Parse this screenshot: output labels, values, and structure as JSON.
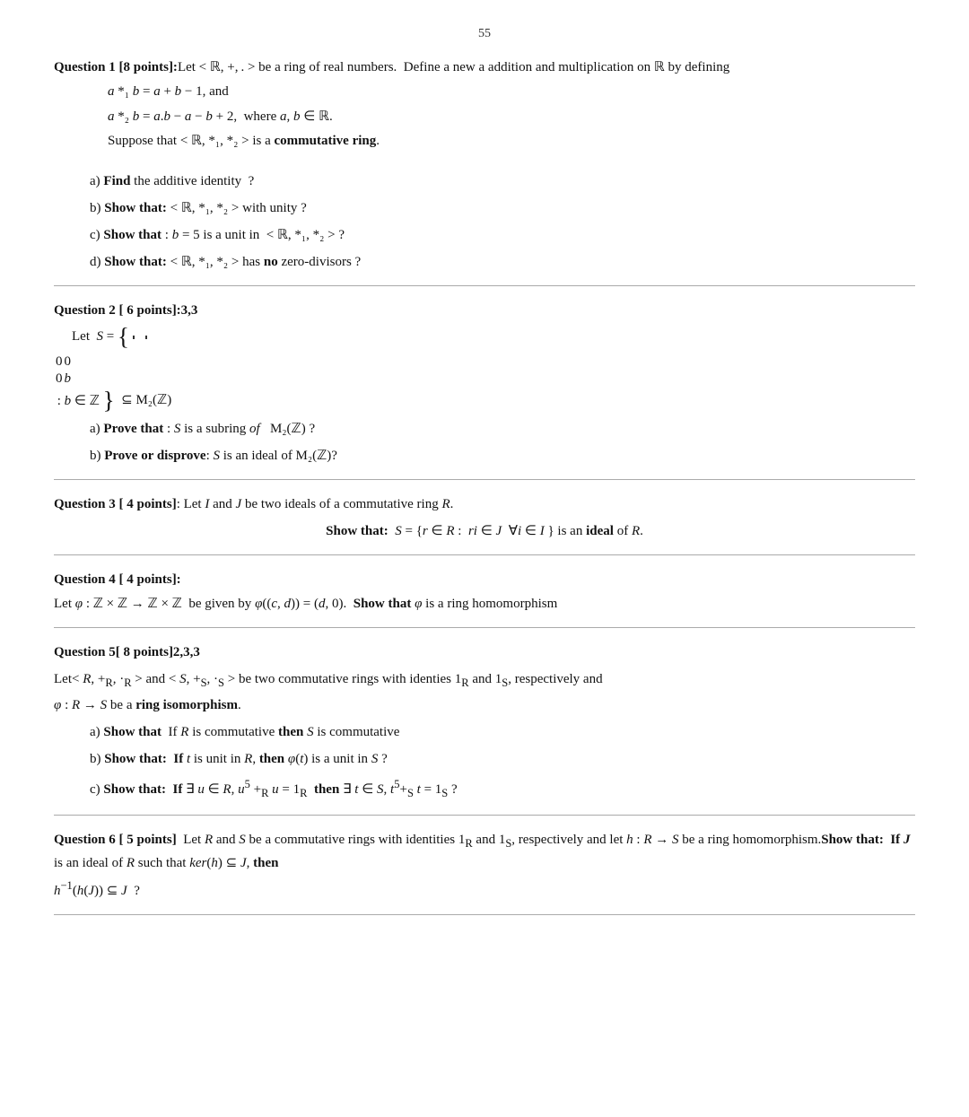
{
  "page": {
    "page_number": "55",
    "questions": [
      {
        "id": "q1",
        "label": "Question 1",
        "points": "[8 points]",
        "intro": "Let < ℝ, +, . > be a ring of real numbers.  Define a new a addition and multiplication on ℝ by defining",
        "definitions": [
          "a *₁ b = a + b − 1, and",
          "a *₂ b = a.b − a − b + 2,  where a, b ∈ ℝ.",
          "Suppose that < ℝ, *₁, *₂ > is a commutative ring."
        ],
        "parts": [
          {
            "label": "a)",
            "bold": "Find",
            "rest": " the additive identity  ?"
          },
          {
            "label": "b)",
            "bold": "Show that:",
            "rest": " < ℝ, *₁, *₂ > with unity ?"
          },
          {
            "label": "c)",
            "bold": "Show that",
            "rest": " : b = 5 is a unit in  < ℝ, *₁, *₂ > ?"
          },
          {
            "label": "d)",
            "bold": "Show that:",
            "rest": " < ℝ, *₁, *₂ > has no zero-divisors ?"
          }
        ]
      },
      {
        "id": "q2",
        "label": "Question 2",
        "points": "[ 6 points]",
        "sub_label": ":3,3",
        "parts": [
          {
            "label": "a)",
            "bold": "Prove that",
            "rest": " : S is a subring of  M₂(ℤ) ?"
          },
          {
            "label": "b)",
            "bold": "Prove or disprove",
            "rest": ": S is an ideal of M₂(ℤ)?"
          }
        ]
      },
      {
        "id": "q3",
        "label": "Question 3",
        "points": "[ 4 points]",
        "intro": "Let I and J be two ideals of a commutative ring R.",
        "show_label": "Show that:",
        "show_text": " S = {r ∈ R :  ri ∈ J  ∀i ∈ I } is an ideal of R."
      },
      {
        "id": "q4",
        "label": "Question 4",
        "points": "[ 4 points]",
        "line1": "Let φ : ℤ × ℤ → ℤ × ℤ  be given by φ((c, d)) = (d, 0).",
        "bold_part": "Show that",
        "rest_part": " φ is a ring homomorphism"
      },
      {
        "id": "q5",
        "label": "Question 5",
        "points": "[ 8 points]",
        "sub_label": "2,3,3",
        "intro1": "Let< R, +ᴿ, ·ᴿ > and < S, +ₛ, ·ₛ > be two commutative rings with identies 1ᴿ and 1ₛ, respectively and",
        "intro2": "φ : R → S be a ring isomorphism.",
        "parts": [
          {
            "label": "a)",
            "bold": "Show that",
            "rest": "  If R is commutative then S is commutative"
          },
          {
            "label": "b)",
            "bold": "Show that:",
            "rest": "  If t is unit in R, then φ(t) is a unit in S ?"
          },
          {
            "label": "c)",
            "bold": "Show that:",
            "rest": "  If ∃ u ∈ R, u⁵ +ᴿ u = 1ᴿ  then ∃ t ∈ S, t⁵+ₛ t = 1ₛ ?"
          }
        ]
      },
      {
        "id": "q6",
        "label": "Question 6",
        "points": "[ 5 points]",
        "intro": "Let R and S be a commutative rings with identities 1ᴿ and 1ₛ, respectively and let h : R → S be a ring homomorphism.",
        "show_bold": "Show that:",
        "show_rest": "  If J  is an ideal of R such that ker(h) ⊆ J, then",
        "last_line": "h⁻¹(h(J)) ⊆ J  ?"
      }
    ]
  }
}
